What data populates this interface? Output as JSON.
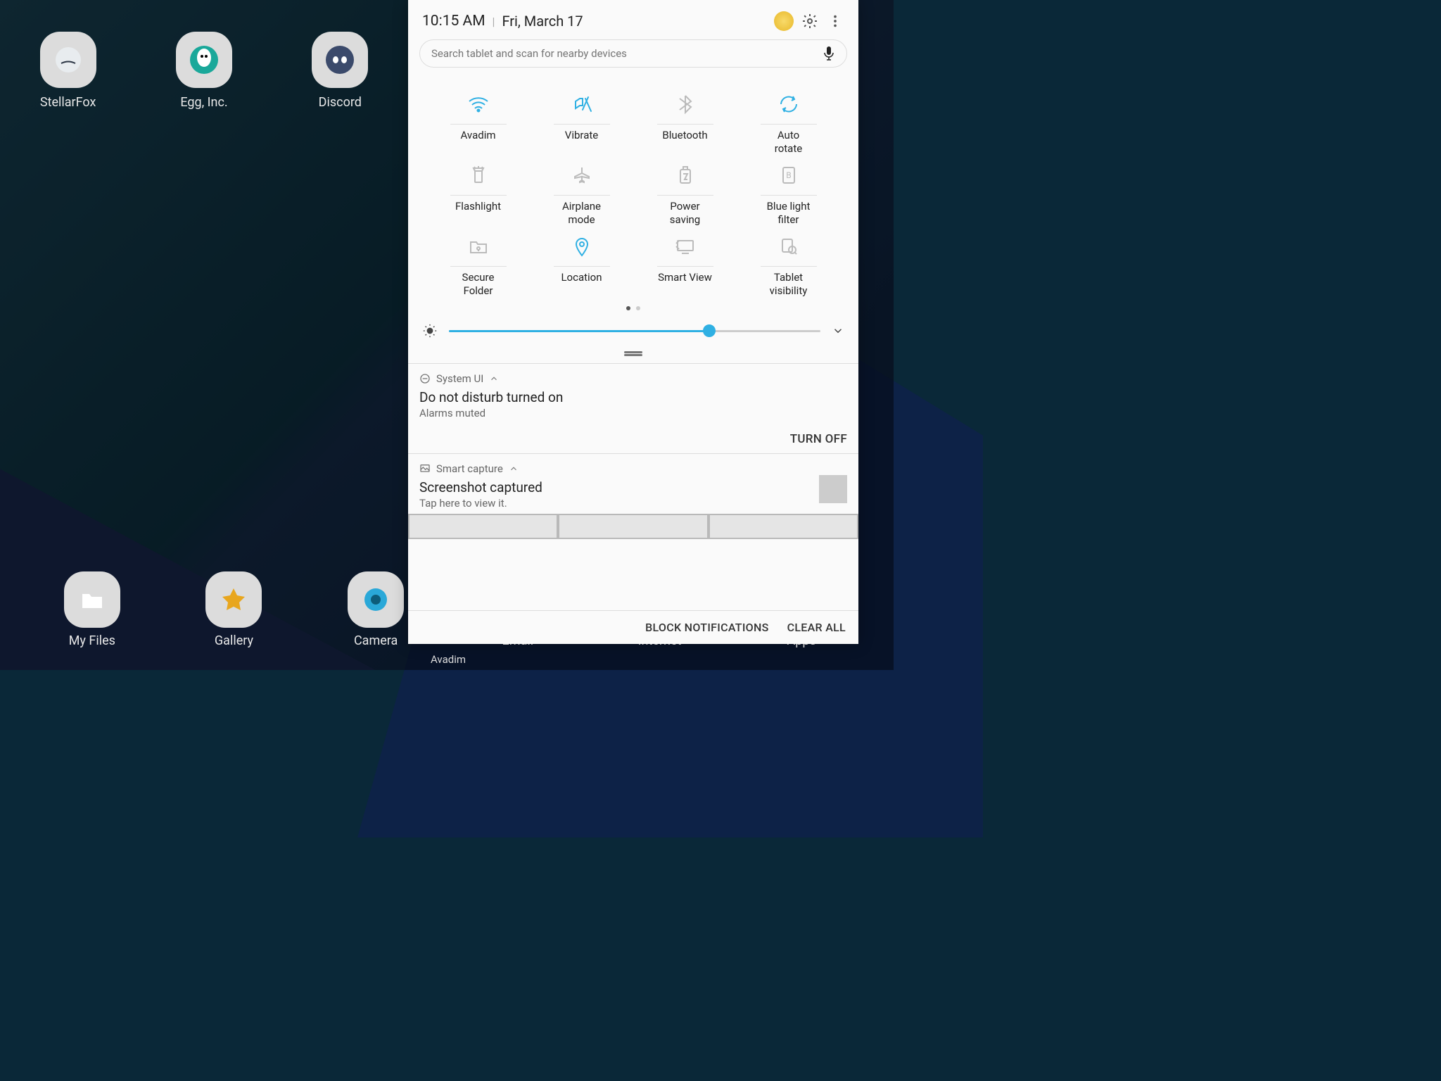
{
  "header": {
    "time": "10:15 AM",
    "sep": "|",
    "date": "Fri, March 17"
  },
  "search": {
    "placeholder": "Search tablet and scan for nearby devices"
  },
  "qs": [
    {
      "label": "Avadim",
      "active": true,
      "icon": "wifi"
    },
    {
      "label": "Vibrate",
      "active": true,
      "icon": "vibrate"
    },
    {
      "label": "Bluetooth",
      "active": false,
      "icon": "bluetooth"
    },
    {
      "label": "Auto\nrotate",
      "active": true,
      "icon": "rotate"
    },
    {
      "label": "Flashlight",
      "active": false,
      "icon": "flashlight"
    },
    {
      "label": "Airplane\nmode",
      "active": false,
      "icon": "airplane"
    },
    {
      "label": "Power\nsaving",
      "active": false,
      "icon": "power"
    },
    {
      "label": "Blue light\nfilter",
      "active": false,
      "icon": "bluelight"
    },
    {
      "label": "Secure\nFolder",
      "active": false,
      "icon": "secure"
    },
    {
      "label": "Location",
      "active": true,
      "icon": "location"
    },
    {
      "label": "Smart View",
      "active": false,
      "icon": "smartview"
    },
    {
      "label": "Tablet\nvisibility",
      "active": false,
      "icon": "visibility"
    }
  ],
  "brightness_percent": 70,
  "notifications": [
    {
      "app": "System UI",
      "title": "Do not disturb turned on",
      "sub": "Alarms muted",
      "action": "TURN OFF"
    },
    {
      "app": "Smart capture",
      "title": "Screenshot captured",
      "sub": "Tap here to view it."
    }
  ],
  "bottom": {
    "block": "BLOCK NOTIFICATIONS",
    "clear": "CLEAR ALL"
  },
  "home": [
    {
      "label": "StellarFox"
    },
    {
      "label": "Egg, Inc."
    },
    {
      "label": "Discord"
    }
  ],
  "dock": [
    {
      "label": "My Files"
    },
    {
      "label": "Gallery"
    },
    {
      "label": "Camera"
    },
    {
      "label": "Email"
    },
    {
      "label": "Internet"
    },
    {
      "label": "Apps"
    }
  ],
  "status": {
    "wifi": "Avadim"
  }
}
